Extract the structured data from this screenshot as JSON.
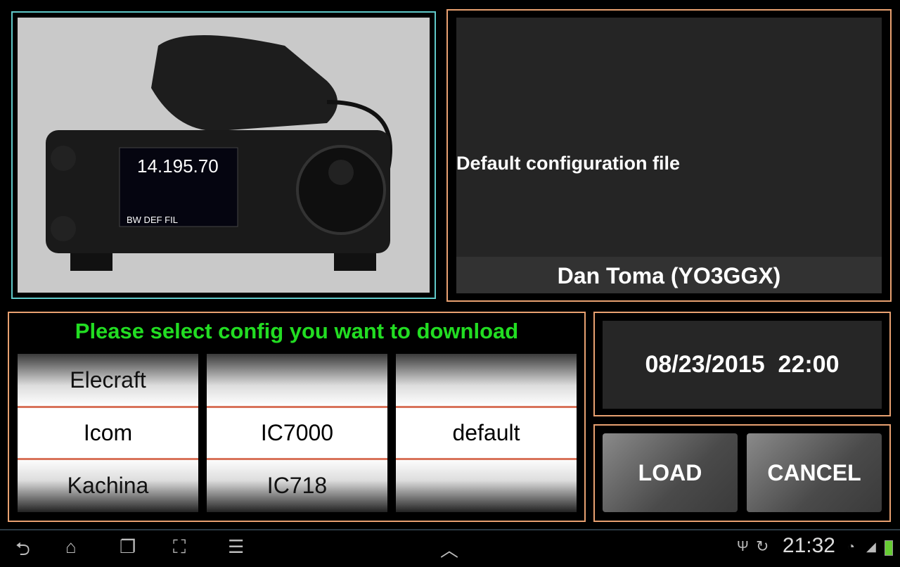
{
  "image": {
    "alt_text_on_radio": {
      "frequency": "14.195.70",
      "buttons": [
        "BW",
        "DEF",
        "FIL"
      ]
    }
  },
  "info": {
    "description": "Default configuration file",
    "author": "Dan Toma (YO3GGX)"
  },
  "picker": {
    "title": "Please select config you want to download",
    "columns": [
      {
        "above": "Elecraft",
        "selected": "Icom",
        "below": "Kachina"
      },
      {
        "above": "",
        "selected": "IC7000",
        "below": "IC718"
      },
      {
        "above": "",
        "selected": "default",
        "below": ""
      }
    ]
  },
  "date": "08/23/2015  22:00",
  "buttons": {
    "load": "LOAD",
    "cancel": "CANCEL"
  },
  "statusbar": {
    "time": "21:32"
  },
  "colors": {
    "title_green": "#22dd22",
    "panel_border": "#e8a070",
    "image_border": "#5fc9c9",
    "selection_line": "#d8735a"
  }
}
